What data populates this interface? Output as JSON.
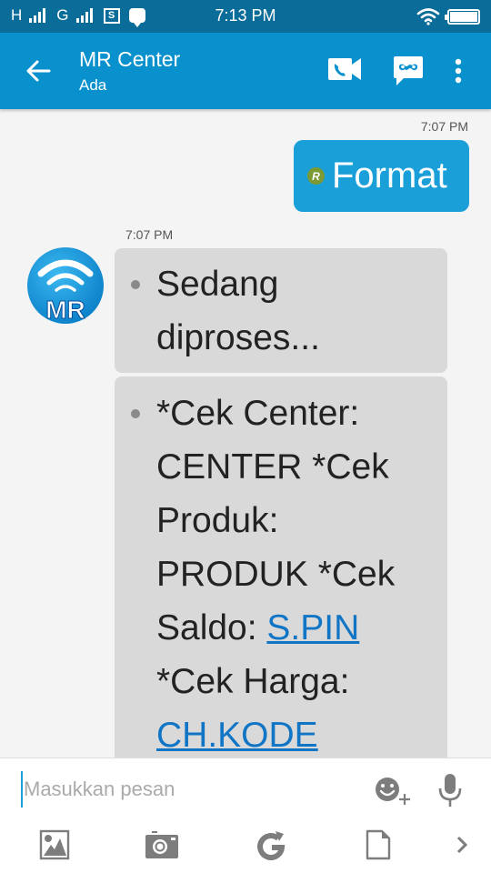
{
  "status_bar": {
    "network_1": "H",
    "network_2": "G",
    "sim_label": "S",
    "time": "7:13 PM",
    "battery_level": 1.0
  },
  "app_bar": {
    "title": "MR Center",
    "subtitle": "Ada",
    "icons": [
      "back-arrow-icon",
      "video-call-icon",
      "bbm-chat-icon",
      "more-vert-icon"
    ]
  },
  "chat": {
    "messages": [
      {
        "direction": "outgoing",
        "timestamp": "7:07 PM",
        "badge": "R",
        "text": "Format",
        "bubble_color": "#1a9fd8"
      },
      {
        "direction": "incoming",
        "timestamp": "7:07 PM",
        "avatar_text": "MR",
        "parts": [
          {
            "text": "Sedang diproses..."
          },
          {
            "text_1": "*Cek Center: CENTER *Cek Produk: PRODUK *Cek Saldo: ",
            "link_1": "S.PIN",
            "text_2": " *Cek Harga: ",
            "link_2": "CH.KODE"
          }
        ]
      }
    ]
  },
  "composer": {
    "placeholder": "Masukkan pesan",
    "value": "",
    "actions": [
      "emoji-add-icon",
      "microphone-icon"
    ],
    "toolbar": [
      "gallery-icon",
      "camera-icon",
      "gif-refresh-icon",
      "file-icon",
      "chevron-right-icon"
    ]
  },
  "colors": {
    "status_bar": "#0a6d99",
    "app_bar": "#0891cd",
    "outgoing_bubble": "#1a9fd8",
    "incoming_bubble": "#d9d9d9",
    "link": "#1175c6",
    "badge": "#7b9a33"
  }
}
